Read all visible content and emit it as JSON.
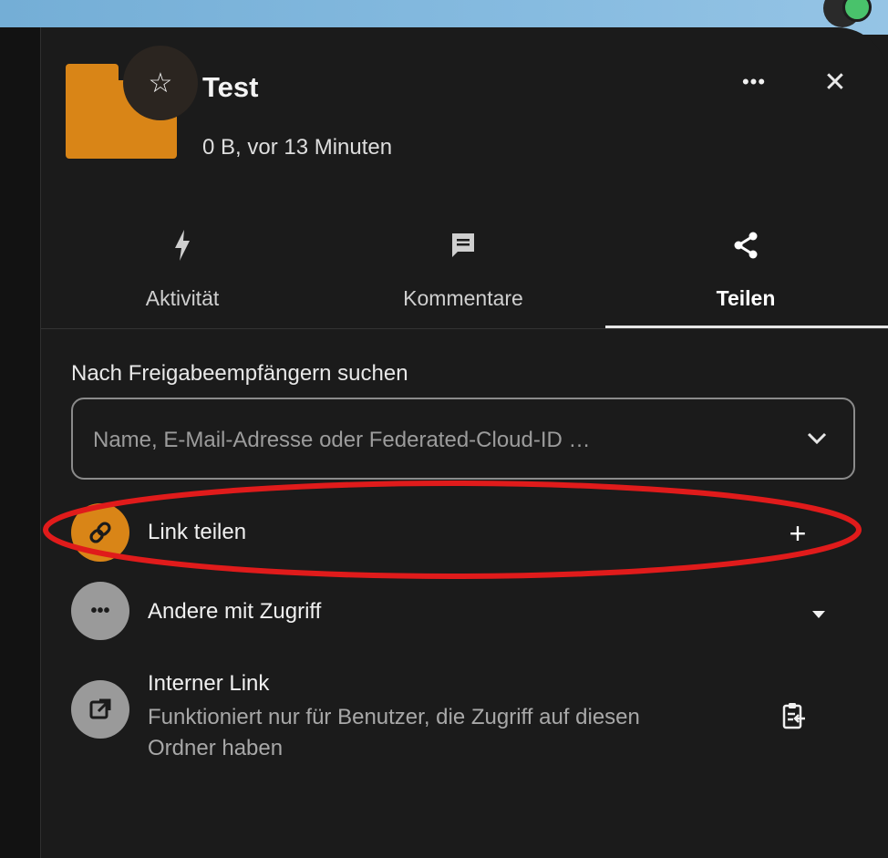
{
  "header": {
    "title": "Test",
    "subtitle": "0 B, vor 13 Minuten",
    "more_label": "•••",
    "close_label": "✕",
    "favorite_glyph": "☆"
  },
  "tabs": [
    {
      "label": "Aktivität",
      "icon": "lightning-icon",
      "active": false
    },
    {
      "label": "Kommentare",
      "icon": "comment-icon",
      "active": false
    },
    {
      "label": "Teilen",
      "icon": "share-icon",
      "active": true
    }
  ],
  "search": {
    "label": "Nach Freigabeempfängern suchen",
    "placeholder": "Name, E-Mail-Adresse oder Federated-Cloud-ID …",
    "value": ""
  },
  "share_link": {
    "label": "Link teilen",
    "add_label": "+",
    "icon": "link-icon"
  },
  "others": {
    "label": "Andere mit Zugriff",
    "icon_glyph": "•••",
    "icon": "more-icon"
  },
  "internal_link": {
    "title": "Interner Link",
    "description": "Funktioniert nur für Benutzer, die Zugriff auf diesen Ordner haben",
    "icon": "external-link-icon",
    "action_icon": "clipboard-icon"
  },
  "colors": {
    "background": "#1b1b1b",
    "folder": "#d98517",
    "annotation": "#e01b1b",
    "accent_bar": "#74aed6"
  }
}
